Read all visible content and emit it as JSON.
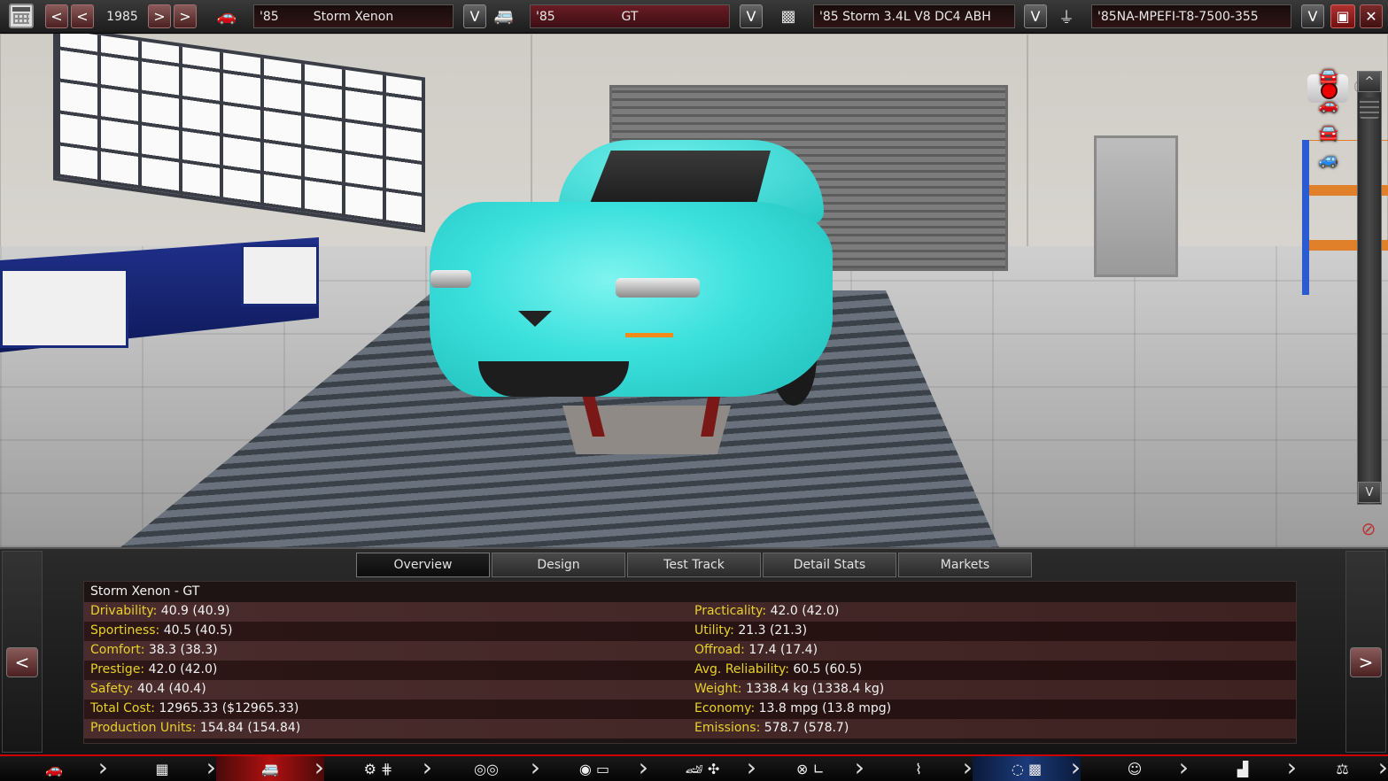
{
  "topbar": {
    "year": "1985",
    "model_year": "'85",
    "model_name": "Storm Xenon",
    "trim_year": "'85",
    "trim_name": "GT",
    "engine": "'85 Storm 3.4L V8 DC4 ABH",
    "engine_variant": "'85NA-MPEFI-T8-7500-355",
    "prev_label": "<",
    "next_label": ">",
    "dropdown_label": "V"
  },
  "scene": {
    "scroll_up": "^",
    "scroll_down": "V",
    "car_color": "#3ae0dc"
  },
  "tabs": [
    {
      "label": "Overview",
      "active": true
    },
    {
      "label": "Design",
      "active": false
    },
    {
      "label": "Test Track",
      "active": false
    },
    {
      "label": "Detail Stats",
      "active": false
    },
    {
      "label": "Markets",
      "active": false
    }
  ],
  "stats": {
    "title": "Storm Xenon - GT",
    "left": [
      {
        "label": "Drivability:",
        "value": "40.9 (40.9)"
      },
      {
        "label": "Sportiness:",
        "value": "40.5 (40.5)"
      },
      {
        "label": "Comfort:",
        "value": "38.3 (38.3)"
      },
      {
        "label": "Prestige:",
        "value": "42.0 (42.0)"
      },
      {
        "label": "Safety:",
        "value": "40.4 (40.4)"
      },
      {
        "label": "Total Cost:",
        "value": "12965.33 ($12965.33)"
      },
      {
        "label": "Production Units:",
        "value": "154.84 (154.84)"
      }
    ],
    "right": [
      {
        "label": "Practicality:",
        "value": "42.0 (42.0)"
      },
      {
        "label": "Utility:",
        "value": "21.3 (21.3)"
      },
      {
        "label": "Offroad:",
        "value": "17.4 (17.4)"
      },
      {
        "label": "Avg. Reliability:",
        "value": "60.5 (60.5)"
      },
      {
        "label": "Weight:",
        "value": "1338.4 kg (1338.4 kg)"
      },
      {
        "label": "Economy:",
        "value": "13.8 mpg (13.8 mpg)"
      },
      {
        "label": "Emissions:",
        "value": "578.7 (578.7)"
      }
    ],
    "label_color": "#e7d22a"
  },
  "panel_nav": {
    "prev": "<",
    "next": ">"
  },
  "toolbar": [
    {
      "icon": "car-model-icon",
      "glyph": "🚗"
    },
    {
      "icon": "chassis-icon",
      "glyph": "▦"
    },
    {
      "icon": "trim-icon",
      "glyph": "🚐"
    },
    {
      "icon": "engine-gearbox-icon",
      "glyph": "⚙ ⋕"
    },
    {
      "icon": "wheels-icon",
      "glyph": "◎◎"
    },
    {
      "icon": "tires-brakes-icon",
      "glyph": "◉ ▭"
    },
    {
      "icon": "body-aero-icon",
      "glyph": "🏎 ✣"
    },
    {
      "icon": "interior-icon",
      "glyph": "⊗ ∟"
    },
    {
      "icon": "suspension-icon",
      "glyph": "⌇"
    },
    {
      "icon": "test-track-icon",
      "glyph": "◌ ▩"
    },
    {
      "icon": "research-icon",
      "glyph": "☺"
    },
    {
      "icon": "factory-icon",
      "glyph": "▟"
    },
    {
      "icon": "balance-icon",
      "glyph": "⚖"
    }
  ]
}
